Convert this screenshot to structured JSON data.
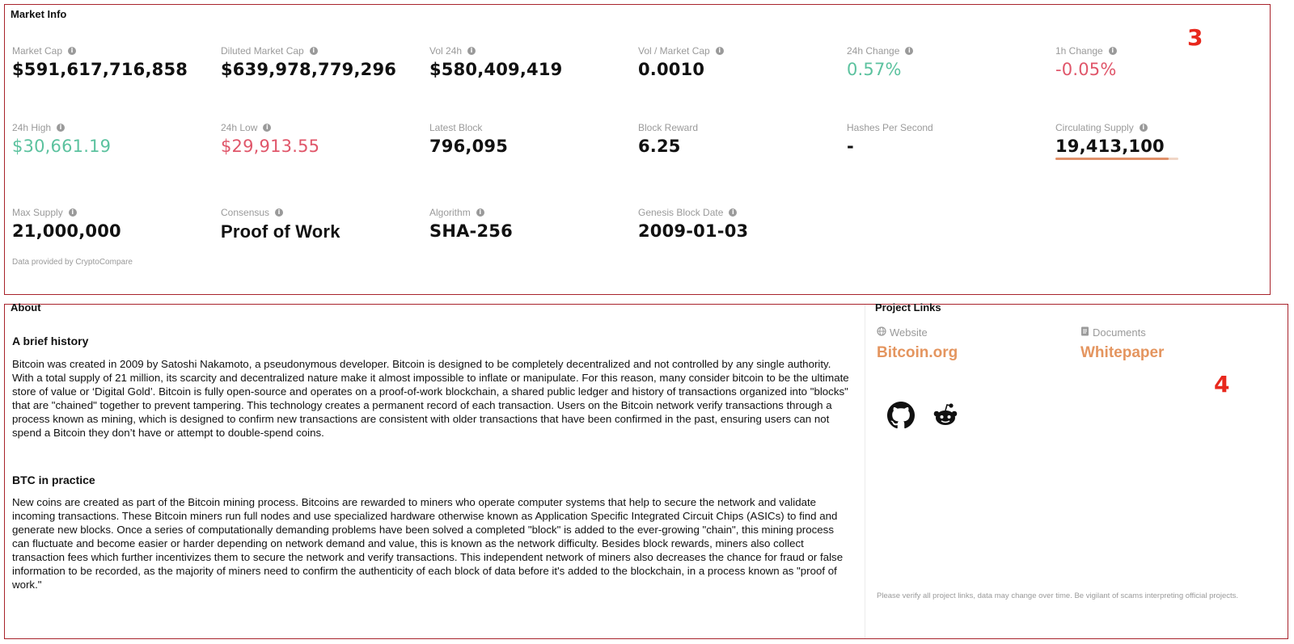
{
  "market": {
    "title": "Market Info",
    "marker": "3",
    "credit": "Data provided by CryptoCompare",
    "stats": {
      "market_cap": {
        "label": "Market Cap",
        "value": "$591,617,716,858"
      },
      "diluted_cap": {
        "label": "Diluted Market Cap",
        "value": "$639,978,779,296"
      },
      "vol_24h": {
        "label": "Vol 24h",
        "value": "$580,409,419"
      },
      "vol_market": {
        "label": "Vol / Market Cap",
        "value": "0.0010"
      },
      "change_24h": {
        "label": "24h Change",
        "value": "0.57%"
      },
      "change_1h": {
        "label": "1h Change",
        "value": "-0.05%"
      },
      "high_24h": {
        "label": "24h High",
        "value": "$30,661.19"
      },
      "low_24h": {
        "label": "24h Low",
        "value": "$29,913.55"
      },
      "latest_block": {
        "label": "Latest Block",
        "value": "796,095"
      },
      "block_reward": {
        "label": "Block Reward",
        "value": "6.25"
      },
      "hashes": {
        "label": "Hashes Per Second",
        "value": "-"
      },
      "circ_supply": {
        "label": "Circulating Supply",
        "value": "19,413,100",
        "fraction_of_max": 0.924
      },
      "max_supply": {
        "label": "Max Supply",
        "value": "21,000,000"
      },
      "consensus": {
        "label": "Consensus",
        "value": "Proof of Work"
      },
      "algorithm": {
        "label": "Algorithm",
        "value": "SHA-256"
      },
      "genesis": {
        "label": "Genesis Block Date",
        "value": "2009-01-03"
      }
    },
    "colors": {
      "positive": "#5cc29f",
      "negative": "#e0566a",
      "accent": "#e4955f",
      "frame": "#a8232b"
    }
  },
  "about": {
    "title": "About",
    "marker": "4",
    "history_heading": "A brief history",
    "history_text": "Bitcoin was created in 2009 by Satoshi Nakamoto, a pseudonymous developer. Bitcoin is designed to be completely decentralized and not controlled by any single authority. With a total supply of 21 million, its scarcity and decentralized nature make it almost impossible to inflate or manipulate. For this reason, many consider bitcoin to be the ultimate store of value or ‘Digital Gold’. Bitcoin is fully open-source and operates on a proof-of-work blockchain, a shared public ledger and history of transactions organized into \"blocks\" that are \"chained\" together to prevent tampering. This technology creates a permanent record of each transaction. Users on the Bitcoin network verify transactions through a process known as mining, which is designed to confirm new transactions are consistent with older transactions that have been confirmed in the past, ensuring users can not spend a Bitcoin they don’t have or attempt to double-spend coins.",
    "practice_heading": "BTC in practice",
    "practice_text": "New coins are created as part of the Bitcoin mining process. Bitcoins are rewarded to miners who operate computer systems that help to secure the network and validate incoming transactions. These Bitcoin miners run full nodes and use specialized hardware otherwise known as Application Specific Integrated Circuit Chips (ASICs) to find and generate new blocks. Once a series of computationally demanding problems have been solved a completed \"block\" is added to the ever-growing \"chain\", this mining process can fluctuate and become easier or harder depending on network demand and value, this is known as the network difficulty. Besides block rewards, miners also collect transaction fees which further incentivizes them to secure the network and verify transactions. This independent network of miners also decreases the chance for fraud or false information to be recorded, as the majority of miners need to confirm the authenticity of each block of data before it's added to the blockchain, in a process known as \"proof of work.\""
  },
  "project_links": {
    "title": "Project Links",
    "website_label": "Website",
    "website_link": "Bitcoin.org",
    "documents_label": "Documents",
    "documents_link": "Whitepaper",
    "social_icons": [
      "github-icon",
      "reddit-icon"
    ],
    "disclaimer": "Please verify all project links, data may change over time. Be vigilant of scams interpreting official projects."
  }
}
